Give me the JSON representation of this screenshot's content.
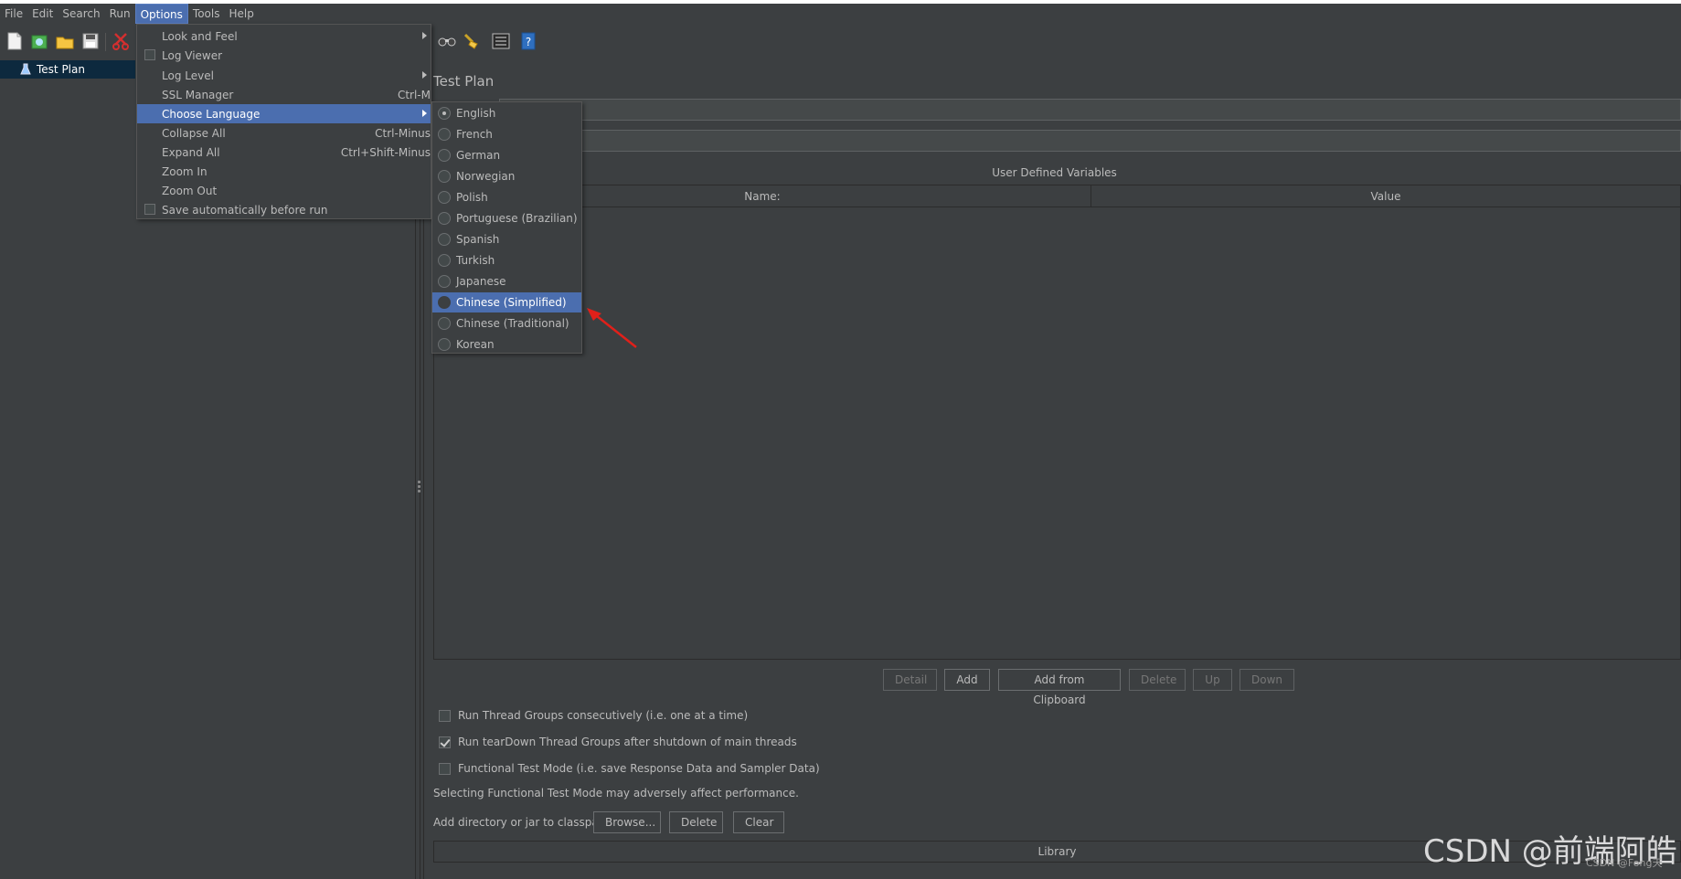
{
  "menubar": {
    "items": [
      "File",
      "Edit",
      "Search",
      "Run",
      "Options",
      "Tools",
      "Help"
    ],
    "active": "Options"
  },
  "toolbar": {
    "icons": [
      "new-icon",
      "templates-icon",
      "open-icon",
      "save-icon",
      "cut-icon",
      "binoculars-icon",
      "broom-icon",
      "list-icon",
      "help-icon"
    ]
  },
  "tree": {
    "root_label": "Test Plan"
  },
  "options_menu": {
    "items": [
      {
        "label": "Look and Feel",
        "shortcut": "",
        "submenu": true,
        "checkbox": false
      },
      {
        "label": "Log Viewer",
        "shortcut": "",
        "submenu": false,
        "checkbox": true
      },
      {
        "label": "Log Level",
        "shortcut": "",
        "submenu": true,
        "checkbox": false
      },
      {
        "label": "SSL Manager",
        "shortcut": "Ctrl-M",
        "submenu": false,
        "checkbox": false
      },
      {
        "label": "Choose Language",
        "shortcut": "",
        "submenu": true,
        "checkbox": false
      },
      {
        "label": "Collapse All",
        "shortcut": "Ctrl-Minus",
        "submenu": false,
        "checkbox": false
      },
      {
        "label": "Expand All",
        "shortcut": "Ctrl+Shift-Minus",
        "submenu": false,
        "checkbox": false
      },
      {
        "label": "Zoom In",
        "shortcut": "",
        "submenu": false,
        "checkbox": false
      },
      {
        "label": "Zoom Out",
        "shortcut": "",
        "submenu": false,
        "checkbox": false
      },
      {
        "label": "Save automatically before run",
        "shortcut": "",
        "submenu": false,
        "checkbox": true
      }
    ],
    "highlighted": "Choose Language"
  },
  "language_menu": {
    "items": [
      "English",
      "French",
      "German",
      "Norwegian",
      "Polish",
      "Portuguese (Brazilian)",
      "Spanish",
      "Turkish",
      "Japanese",
      "Chinese (Simplified)",
      "Chinese (Traditional)",
      "Korean"
    ],
    "selected": "English",
    "highlighted": "Chinese (Simplified)"
  },
  "main": {
    "title": "Test Plan",
    "udv_title": "User Defined Variables",
    "udv_columns": [
      "Name:",
      "Value"
    ],
    "udv_buttons": [
      {
        "label": "Detail",
        "enabled": false
      },
      {
        "label": "Add",
        "enabled": true
      },
      {
        "label": "Add from Clipboard",
        "enabled": true
      },
      {
        "label": "Delete",
        "enabled": false
      },
      {
        "label": "Up",
        "enabled": false
      },
      {
        "label": "Down",
        "enabled": false
      }
    ],
    "options": [
      {
        "label": "Run Thread Groups consecutively (i.e. one at a time)",
        "checked": false
      },
      {
        "label": "Run tearDown Thread Groups after shutdown of main threads",
        "checked": true
      },
      {
        "label": "Functional Test Mode (i.e. save Response Data and Sampler Data)",
        "checked": false
      }
    ],
    "functional_note": "Selecting Functional Test Mode may adversely affect performance.",
    "classpath_label": "Add directory or jar to classpath",
    "classpath_buttons": [
      "Browse...",
      "Delete",
      "Clear"
    ],
    "library_header": "Library"
  },
  "watermark": {
    "large": "CSDN @前端阿皓",
    "small": "CSDN @Fong天"
  },
  "colors": {
    "background": "#3c3f41",
    "selection": "#4b6eaf",
    "tree_selection": "#0d293e",
    "text": "#bbbbbb",
    "annotation_arrow": "#e0201a"
  }
}
